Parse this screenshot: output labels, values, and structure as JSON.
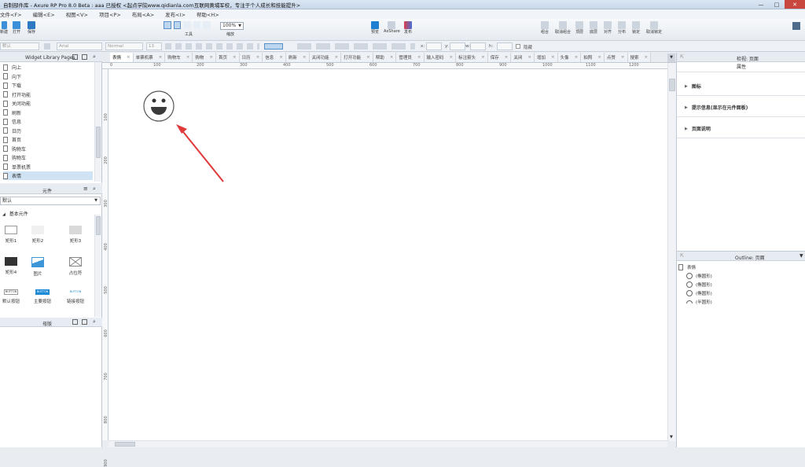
{
  "window": {
    "title": "自制部件库 - Axure RP Pro 8.0 Beta : aaa 已授权    <起点学院www.qidianla.com互联网黄埔军校，专注于个人成长和技能提升>",
    "controls": {
      "minimize": "—",
      "maximize": "□",
      "close": "✕"
    }
  },
  "menu": [
    "文件<F>",
    "编辑<E>",
    "视图<V>",
    "项目<P>",
    "布局<A>",
    "发布<I>",
    "帮助<H>"
  ],
  "toolbar": {
    "new_label": "新建",
    "open_label": "打开",
    "save_label": "保存",
    "tools_label": "工具",
    "zoom_label": "缩放",
    "zoom_value": "100%",
    "preview_label": "预览",
    "axshare_label": "AxShare",
    "publish_label": "发布",
    "arrange": [
      "组合",
      "取消组合",
      "顶层",
      "底层",
      "对齐",
      "分布",
      "锁定",
      "取消锁定"
    ]
  },
  "formatbar": {
    "style": "默认",
    "font": "Arial",
    "weight": "Normal",
    "size": "13",
    "x_label": "x:",
    "y_label": "y:",
    "w_label": "w:",
    "h_label": "h:",
    "hidden_label": "隐藏"
  },
  "pages_panel": {
    "title": "Widget Library Pages",
    "items": [
      "向上",
      "向下",
      "下载",
      "打开功能",
      "关闭功能",
      "刷新",
      "信息",
      "日历",
      "首页",
      "购物车",
      "购物车",
      "单票机票",
      "表情"
    ],
    "selected_index": 12
  },
  "widgets_panel": {
    "title": "元件",
    "library": "默认",
    "category": "基本元件",
    "items": [
      "矩形1",
      "矩形2",
      "矩形3",
      "矩形4",
      "图片",
      "占位符",
      "默认按钮",
      "主要按钮",
      "链接按钮"
    ],
    "button_text": "BUTTON"
  },
  "masters_panel": {
    "title": "母版"
  },
  "tabs": [
    "表情",
    "单票机票",
    "购物车",
    "购物",
    "首页",
    "日历",
    "信息",
    "刷新",
    "关闭功能",
    "打开功能",
    "帮助",
    "管理员",
    "输入密码",
    "标注箭头",
    "保存",
    "关闭",
    "增加",
    "头像",
    "拍照",
    "点赞",
    "搜索"
  ],
  "active_tab": 0,
  "ruler_h": [
    "0",
    "100",
    "200",
    "300",
    "400",
    "500",
    "600",
    "700",
    "800",
    "900",
    "1000",
    "1100",
    "1200",
    "130"
  ],
  "ruler_v": [
    "100",
    "200",
    "300",
    "400",
    "500",
    "600",
    "700",
    "800",
    "900"
  ],
  "right_panel": {
    "tabs": "检视: 页面",
    "title": "属性",
    "sections": [
      "图标",
      "提示信息(显示在元件面板)",
      "页面说明"
    ]
  },
  "outline_panel": {
    "title": "Outline: 页面",
    "page": "表情",
    "items": [
      "(椭圆形)",
      "(椭圆形)",
      "(椭圆形)",
      "(半圆形)"
    ]
  },
  "colors": {
    "accent": "#2d7fd3",
    "annotation_arrow": "#e03a3a",
    "selection": "#cfe3f5"
  },
  "icons": {
    "smiley": "smiley-face-icon",
    "page": "document-icon"
  }
}
